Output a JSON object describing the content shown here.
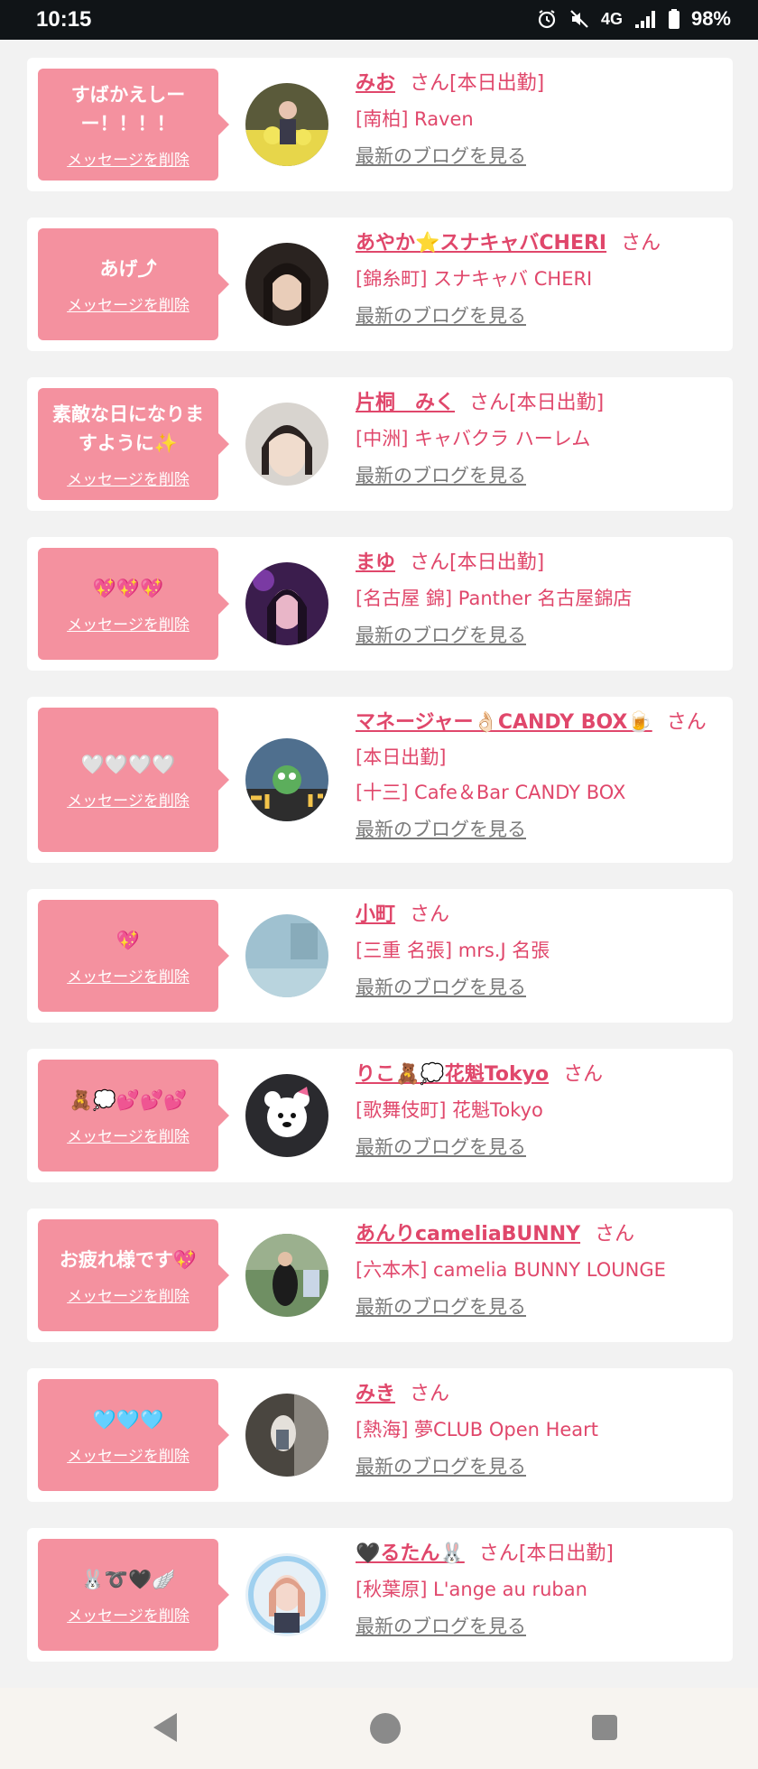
{
  "status_bar": {
    "time": "10:15",
    "network": "4G",
    "battery": "98%",
    "icons": [
      "alarm-icon",
      "mute-icon",
      "signal-icon",
      "battery-icon"
    ]
  },
  "delete_label": "メッセージを削除",
  "blog_label": "最新のブログを見る",
  "honorific": "さん",
  "colors": {
    "accent": "#e0476b",
    "bubble": "#f4919f",
    "link_gray": "#7a7a7a"
  },
  "messages": [
    {
      "message": "すばかえしーー！！！！",
      "name": "みお",
      "status": "[本日出勤]",
      "shop": "[南柏] Raven"
    },
    {
      "message": "あげ⤴",
      "name": "あやか⭐スナキャバCHERI",
      "status": "",
      "shop": "[錦糸町] スナキャバ CHERI"
    },
    {
      "message": "素敵な日になりますように✨",
      "name": "片桐　みく",
      "status": "[本日出勤]",
      "shop": "[中洲] キャバクラ ハーレム"
    },
    {
      "message": "💖💖💖",
      "name": "まゆ",
      "status": "[本日出勤]",
      "shop": "[名古屋 錦] Panther 名古屋錦店"
    },
    {
      "message": "🤍🤍🤍🤍",
      "name": "マネージャー👌🏻CANDY BOX🍺",
      "status": "[本日出勤]",
      "shop": "[十三] Cafe＆Bar CANDY BOX"
    },
    {
      "message": "💖",
      "name": "小町",
      "status": "",
      "shop": "[三重 名張] mrs.J 名張"
    },
    {
      "message": "🧸💭💕💕💕",
      "name": "りこ🧸💭花魁Tokyo",
      "status": "",
      "shop": "[歌舞伎町] 花魁Tokyo"
    },
    {
      "message": "お疲れ様です💖",
      "name": "あんりcameliaBUNNY",
      "status": "",
      "shop": "[六本木] camelia BUNNY LOUNGE"
    },
    {
      "message": "🩵🩵🩵",
      "name": "みき",
      "status": "",
      "shop": "[熱海] 夢CLUB Open Heart"
    },
    {
      "message": "🐰➰🖤🪽",
      "name": "🖤るたん🐰",
      "status": "[本日出勤]",
      "shop": "[秋葉原] L'ange au ruban"
    }
  ],
  "nav": {
    "icons": [
      "back-icon",
      "home-icon",
      "recents-icon"
    ]
  }
}
